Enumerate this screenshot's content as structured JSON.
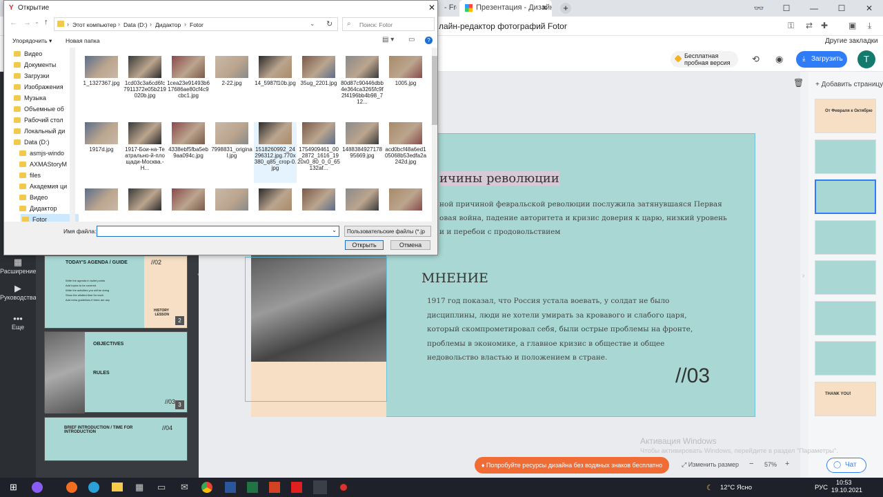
{
  "browser": {
    "tabs": [
      {
        "label": "- Free"
      },
      {
        "label": "Презентация - Дизайн"
      }
    ],
    "page_title": "лайн-редактор фотографий Fotor",
    "bookmarks_label": "Другие закладки"
  },
  "dialog": {
    "title": "Открытие",
    "breadcrumb": [
      "Этот компьютер",
      "Data (D:)",
      "Дидактор",
      "Fotor"
    ],
    "search_placeholder": "Поиск: Fotor",
    "organize_label": "Упорядочить",
    "new_folder_label": "Новая папка",
    "tree": [
      "Видео",
      "Документы",
      "Загрузки",
      "Изображения",
      "Музыка",
      "Объемные об",
      "Рабочий стол",
      "Локальный ди",
      "Data (D:)",
      "asmjs-windo",
      "AXMAStoryM",
      "files",
      "Академия ци",
      "Видео",
      "Дидактор",
      "Fotor"
    ],
    "files": [
      {
        "name": "1_1327367.jpg"
      },
      {
        "name": "1cd03c3a6cd6fc7911372e05b219020b.jpg"
      },
      {
        "name": "1cea23e91493b617686ae80cf4c9cbc1.jpg"
      },
      {
        "name": "2-22.jpg"
      },
      {
        "name": "14_5987f10b.jpg"
      },
      {
        "name": "35ug_2201.jpg"
      },
      {
        "name": "80d87c90446dbb4e364ca3265fc9f2f4196bb4b98_712..."
      },
      {
        "name": "1005.jpg"
      },
      {
        "name": "1917d.jpg"
      },
      {
        "name": "1917-Бои-на-Театрально-й-площади-Москва.-Н..."
      },
      {
        "name": "4338ebf5fba5eb9aa094c.jpg"
      },
      {
        "name": "7998831_original.jpg"
      },
      {
        "name": "1518260992_24296312.jpg.770x380_q85_crop-0.jpg"
      },
      {
        "name": "1754909461_00_2872_1616_1920x0_80_0_0_65132af..."
      },
      {
        "name": "148838492717895669.jpg"
      },
      {
        "name": "acd0bcf48a6ed105068b53edfa2a242d.jpg"
      },
      {
        "name": ""
      },
      {
        "name": ""
      },
      {
        "name": ""
      },
      {
        "name": ""
      },
      {
        "name": ""
      },
      {
        "name": ""
      },
      {
        "name": ""
      },
      {
        "name": ""
      }
    ],
    "filename_label": "Имя файла:",
    "filename_value": "",
    "filetype_value": "Пользовательские файлы (*.jp",
    "open_label": "Открыть",
    "cancel_label": "Отмена"
  },
  "app": {
    "trial_label": "Бесплатная пробная версия",
    "upload_label": "Загрузить",
    "avatar_letter": "T",
    "add_page_label": "Добавить страницу",
    "rail": [
      {
        "label": "Расширение"
      },
      {
        "label": "Руководства"
      },
      {
        "label": "Еще"
      }
    ]
  },
  "thumbs": [
    {
      "title": "TODAY'S AGENDA / GUIDE",
      "num": "//02",
      "badge": "2",
      "text": "Write the agenda in bullet points\nAdd topics to be covered\nWrite the activities you will be doing\nShow the allotted time for each\nAdd extra guidelines if there are any",
      "footer": "HISTORY LESSON"
    },
    {
      "title": "OBJECTIVES",
      "sub": "RULES",
      "num": "//03",
      "badge": "3"
    },
    {
      "title": "BRIEF INTRODUCTION / TIME FOR INTRODUCTION",
      "num": "//04"
    }
  ],
  "slide": {
    "heading": "ичины революции",
    "body_top": "ной причиной февральской революции послужила затянувшаяся Первая\nовая война, падение авторитета и кризис доверия к царю, низкий уровень\nи и перебои с продовольствием",
    "opinion_heading": "МНЕНИЕ",
    "opinion_body": "1917 год показал, что Россия устала воевать, у солдат не было\nдисциплины, люди не хотели умирать за кровавого и слабого царя,\nкоторый скомпрометировал себя, были острые проблемы на фронте,\nпроблемы в экономике, а главное кризис в обществе и общее\nнедовольство властью и положением в стране.",
    "page_num": "//03"
  },
  "right_thumbs": [
    {
      "text": "От Февраля к Октябрю"
    },
    {
      "text": ""
    },
    {
      "text": ""
    },
    {
      "text": ""
    },
    {
      "text": ""
    },
    {
      "text": ""
    },
    {
      "text": ""
    },
    {
      "text": "THANK YOU!"
    }
  ],
  "bottom": {
    "promo_label": "Попробуйте ресурсы дизайна без водяных знаков бесплатно",
    "resize_label": "Изменить размер",
    "zoom": "57%",
    "chat_label": "Чат",
    "activation_title": "Активация Windows",
    "activation_text": "Чтобы активировать Windows, перейдите в раздел \"Параметры\"."
  },
  "taskbar": {
    "weather": "12°C Ясно",
    "lang": "РУС",
    "time": "10:53",
    "date": "19.10.2021"
  }
}
